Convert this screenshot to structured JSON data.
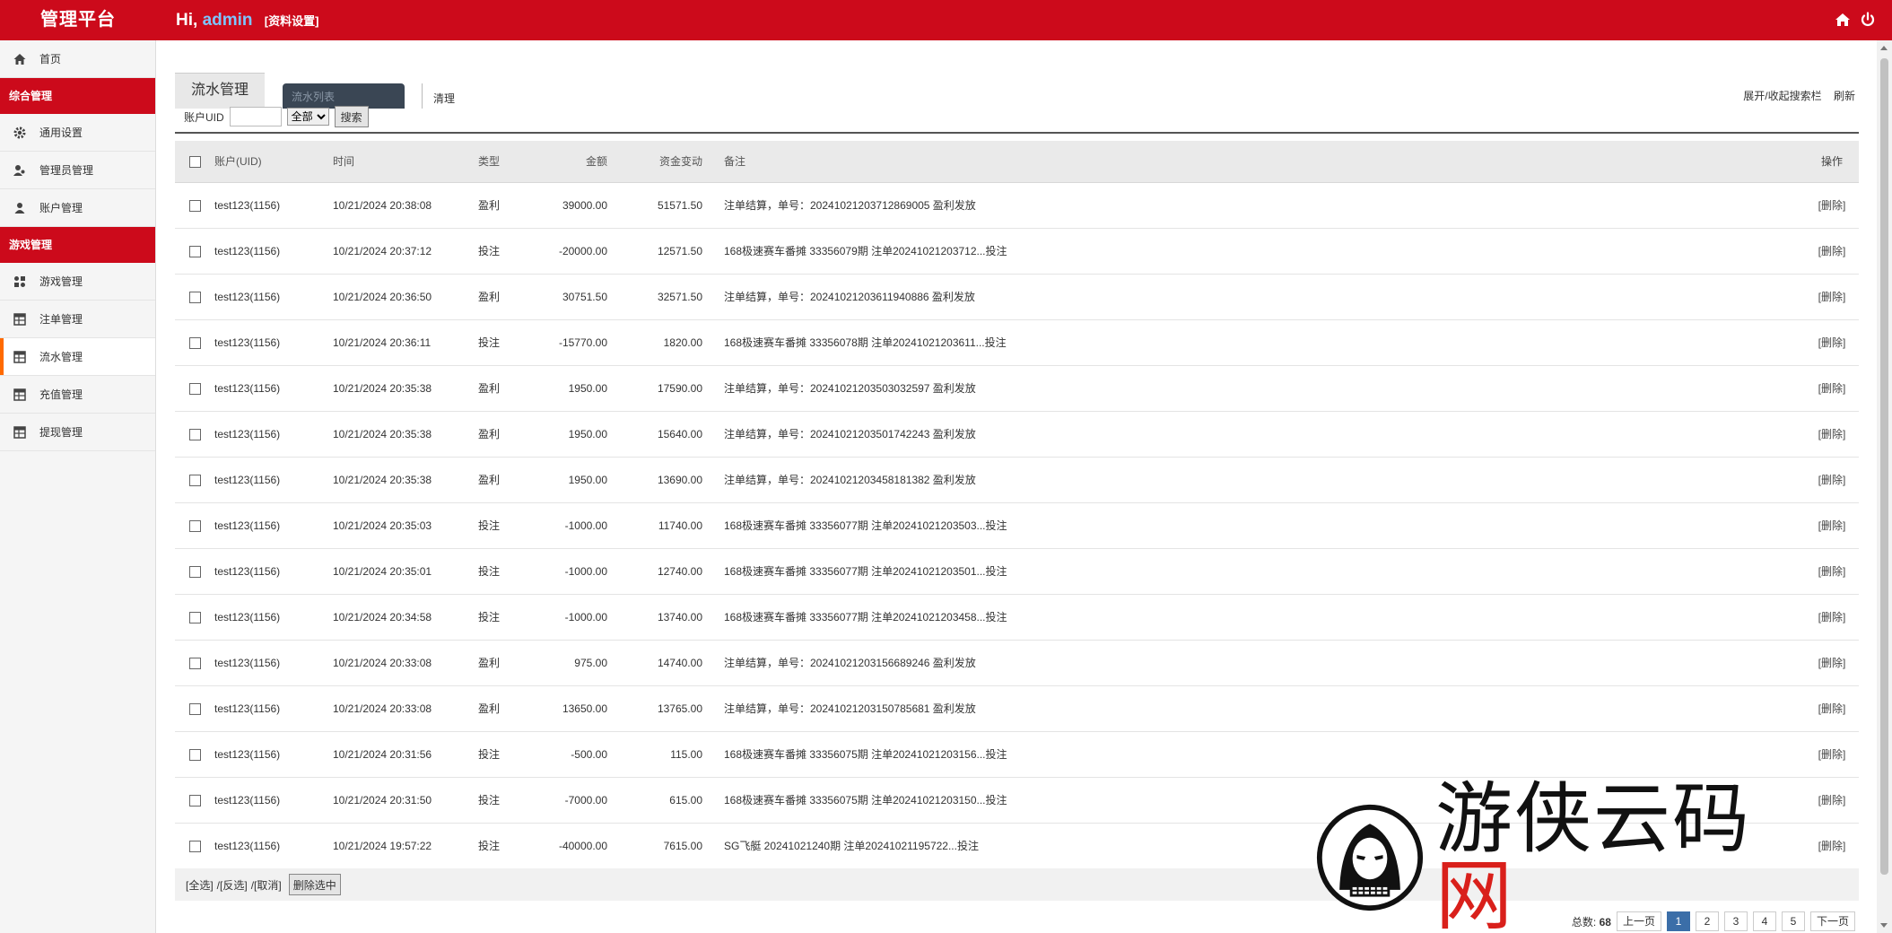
{
  "header": {
    "brand": "管理平台",
    "greeting": "Hi,",
    "username": "admin",
    "profile_link": "[资料设置]",
    "home_icon": "home-icon",
    "power_icon": "power-icon"
  },
  "sidebar": {
    "home": "首页",
    "group1": "综合管理",
    "group1_items": [
      "通用设置",
      "管理员管理",
      "账户管理"
    ],
    "group2": "游戏管理",
    "group2_items": [
      "游戏管理",
      "注单管理",
      "流水管理",
      "充值管理",
      "提现管理"
    ],
    "active": "流水管理"
  },
  "tabs": {
    "main": "流水管理",
    "dark_tab": "流水列表",
    "clear": "清理",
    "toggle_search": "展开/收起搜索栏",
    "refresh": "刷新"
  },
  "search": {
    "uid_label": "账户UID",
    "uid_value": "",
    "select_value": "全部",
    "button": "搜索"
  },
  "table": {
    "headers": [
      "账户(UID)",
      "时间",
      "类型",
      "金额",
      "资金变动",
      "备注",
      "操作"
    ],
    "rows": [
      {
        "uid": "test123(1156)",
        "time": "10/21/2024 20:38:08",
        "type": "盈利",
        "amount": "39000.00",
        "change": "51571.50",
        "note": "注单结算，单号：20241021203712869005 盈利发放",
        "op": "[删除]"
      },
      {
        "uid": "test123(1156)",
        "time": "10/21/2024 20:37:12",
        "type": "投注",
        "amount": "-20000.00",
        "change": "12571.50",
        "note": "168极速赛车番摊 33356079期 注单20241021203712...投注",
        "op": "[删除]"
      },
      {
        "uid": "test123(1156)",
        "time": "10/21/2024 20:36:50",
        "type": "盈利",
        "amount": "30751.50",
        "change": "32571.50",
        "note": "注单结算，单号：20241021203611940886 盈利发放",
        "op": "[删除]"
      },
      {
        "uid": "test123(1156)",
        "time": "10/21/2024 20:36:11",
        "type": "投注",
        "amount": "-15770.00",
        "change": "1820.00",
        "note": "168极速赛车番摊 33356078期 注单20241021203611...投注",
        "op": "[删除]"
      },
      {
        "uid": "test123(1156)",
        "time": "10/21/2024 20:35:38",
        "type": "盈利",
        "amount": "1950.00",
        "change": "17590.00",
        "note": "注单结算，单号：20241021203503032597 盈利发放",
        "op": "[删除]"
      },
      {
        "uid": "test123(1156)",
        "time": "10/21/2024 20:35:38",
        "type": "盈利",
        "amount": "1950.00",
        "change": "15640.00",
        "note": "注单结算，单号：20241021203501742243 盈利发放",
        "op": "[删除]"
      },
      {
        "uid": "test123(1156)",
        "time": "10/21/2024 20:35:38",
        "type": "盈利",
        "amount": "1950.00",
        "change": "13690.00",
        "note": "注单结算，单号：20241021203458181382 盈利发放",
        "op": "[删除]"
      },
      {
        "uid": "test123(1156)",
        "time": "10/21/2024 20:35:03",
        "type": "投注",
        "amount": "-1000.00",
        "change": "11740.00",
        "note": "168极速赛车番摊 33356077期 注单20241021203503...投注",
        "op": "[删除]"
      },
      {
        "uid": "test123(1156)",
        "time": "10/21/2024 20:35:01",
        "type": "投注",
        "amount": "-1000.00",
        "change": "12740.00",
        "note": "168极速赛车番摊 33356077期 注单20241021203501...投注",
        "op": "[删除]"
      },
      {
        "uid": "test123(1156)",
        "time": "10/21/2024 20:34:58",
        "type": "投注",
        "amount": "-1000.00",
        "change": "13740.00",
        "note": "168极速赛车番摊 33356077期 注单20241021203458...投注",
        "op": "[删除]"
      },
      {
        "uid": "test123(1156)",
        "time": "10/21/2024 20:33:08",
        "type": "盈利",
        "amount": "975.00",
        "change": "14740.00",
        "note": "注单结算，单号：20241021203156689246 盈利发放",
        "op": "[删除]"
      },
      {
        "uid": "test123(1156)",
        "time": "10/21/2024 20:33:08",
        "type": "盈利",
        "amount": "13650.00",
        "change": "13765.00",
        "note": "注单结算，单号：20241021203150785681 盈利发放",
        "op": "[删除]"
      },
      {
        "uid": "test123(1156)",
        "time": "10/21/2024 20:31:56",
        "type": "投注",
        "amount": "-500.00",
        "change": "115.00",
        "note": "168极速赛车番摊 33356075期 注单20241021203156...投注",
        "op": "[删除]"
      },
      {
        "uid": "test123(1156)",
        "time": "10/21/2024 20:31:50",
        "type": "投注",
        "amount": "-7000.00",
        "change": "615.00",
        "note": "168极速赛车番摊 33356075期 注单20241021203150...投注",
        "op": "[删除]"
      },
      {
        "uid": "test123(1156)",
        "time": "10/21/2024 19:57:22",
        "type": "投注",
        "amount": "-40000.00",
        "change": "7615.00",
        "note": "SG飞艇 20241021240期 注单20241021195722...投注",
        "op": "[删除]"
      }
    ]
  },
  "footer": {
    "select_all": "[全选]",
    "invert": "/[反选]",
    "cancel": "/[取消]",
    "delete_selected": "删除选中"
  },
  "pager": {
    "total_label": "总数:",
    "total": "68",
    "prev": "上一页",
    "pages": [
      "1",
      "2",
      "3",
      "4",
      "5"
    ],
    "current": "1",
    "next": "下一页"
  },
  "watermark": {
    "text_main": "游侠云码",
    "text_accent": "网"
  },
  "colors": {
    "header_red": "#cc0a1b",
    "accent_orange": "#ff6a00",
    "win": "#c0392b",
    "bet": "#27a844",
    "pager_active": "#3b6ea8"
  }
}
